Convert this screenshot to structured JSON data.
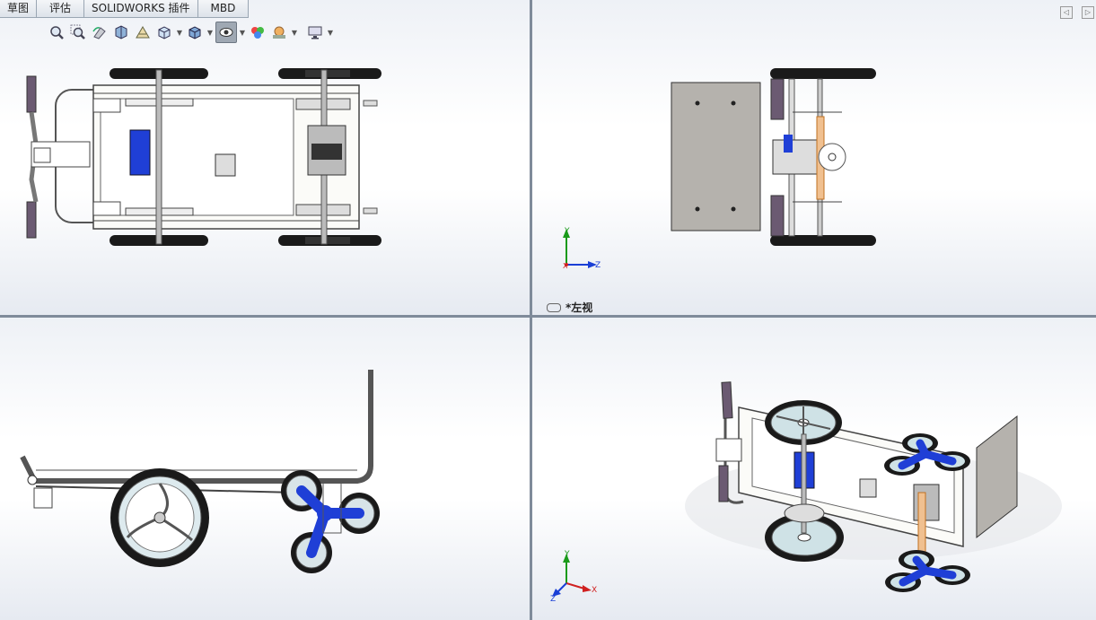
{
  "tabs": [
    {
      "label": "草图"
    },
    {
      "label": "评估"
    },
    {
      "label": "SOLIDWORKS 插件"
    },
    {
      "label": "MBD"
    }
  ],
  "toolbar": {
    "icons": [
      "zoom-to-fit-icon",
      "zoom-area-icon",
      "previous-view-icon",
      "section-view-icon",
      "dynamic-annotation-icon",
      "view-orientation-icon",
      "display-style-icon",
      "hide-show-items-icon",
      "edit-appearance-icon",
      "apply-scene-icon",
      "view-settings-icon"
    ]
  },
  "viewports": {
    "top_left": {
      "name": "top-view"
    },
    "top_right": {
      "name": "left-view",
      "label": "*左视"
    },
    "bottom_left": {
      "name": "front-view"
    },
    "bottom_right": {
      "name": "isometric-view"
    }
  },
  "triad": {
    "x": "X",
    "y": "Y",
    "z": "Z"
  },
  "colors": {
    "tire": "#1a1a1a",
    "frame": "#e8e8e8",
    "blue_part": "#1f3fd6",
    "plate": "#b5b2ad",
    "grip": "#6b5a72",
    "background": "#ffffff"
  }
}
